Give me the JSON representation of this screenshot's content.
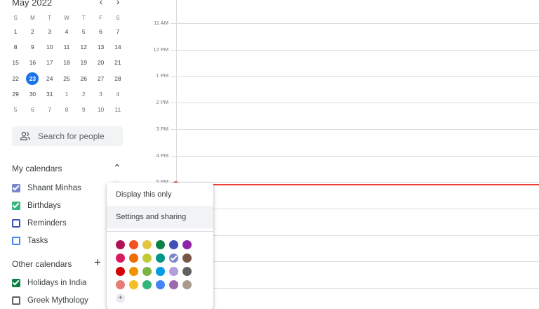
{
  "mini_calendar": {
    "month_label": "May 2022",
    "prev_icon": "chevron-left-icon",
    "next_icon": "chevron-right-icon",
    "weekdays": [
      "S",
      "M",
      "T",
      "W",
      "T",
      "F",
      "S"
    ],
    "weeks": [
      [
        "1",
        "2",
        "3",
        "4",
        "5",
        "6",
        "7"
      ],
      [
        "8",
        "9",
        "10",
        "11",
        "12",
        "13",
        "14"
      ],
      [
        "15",
        "16",
        "17",
        "18",
        "19",
        "20",
        "21"
      ],
      [
        "22",
        "23",
        "24",
        "25",
        "26",
        "27",
        "28"
      ],
      [
        "29",
        "30",
        "31",
        "1",
        "2",
        "3",
        "4"
      ],
      [
        "5",
        "6",
        "7",
        "8",
        "9",
        "10",
        "11"
      ]
    ],
    "today": "23"
  },
  "search": {
    "placeholder": "Search for people",
    "icon": "people-icon"
  },
  "my_calendars": {
    "title": "My calendars",
    "toggle_icon": "chevron-up-icon",
    "items": [
      {
        "label": "Shaant Minhas",
        "checked": true,
        "color": "#7986cb"
      },
      {
        "label": "Birthdays",
        "checked": true,
        "color": "#33b679"
      },
      {
        "label": "Reminders",
        "checked": false,
        "color": "#3f51b5"
      },
      {
        "label": "Tasks",
        "checked": false,
        "color": "#4285f4"
      }
    ]
  },
  "other_calendars": {
    "title": "Other calendars",
    "add_icon": "plus-icon",
    "items": [
      {
        "label": "Holidays in India",
        "checked": true,
        "color": "#0b8043"
      },
      {
        "label": "Greek Mythology",
        "checked": false,
        "color": "#616161"
      }
    ]
  },
  "time_labels": [
    "11 AM",
    "12 PM",
    "1 PM",
    "2 PM",
    "3 PM",
    "4 PM",
    "5 PM"
  ],
  "context_menu": {
    "items": [
      "Display this only",
      "Settings and sharing"
    ],
    "highlighted_index": 1,
    "swatches": [
      [
        "#ad1457",
        "#f4511e",
        "#e4c441",
        "#0b8043",
        "#3f51b5",
        "#8e24aa"
      ],
      [
        "#d81b60",
        "#ef6c00",
        "#c0ca33",
        "#009688",
        "#7986cb",
        "#795548"
      ],
      [
        "#d50000",
        "#f09300",
        "#7cb342",
        "#039be5",
        "#b39ddb",
        "#616161"
      ],
      [
        "#e67c73",
        "#f6bf26",
        "#33b679",
        "#4285f4",
        "#9e69af",
        "#a79b8e"
      ]
    ],
    "selected_swatch": [
      1,
      4
    ],
    "add_color_label": "+"
  },
  "colors": {
    "accent": "#1a73e8",
    "now_line": "#ea4335"
  }
}
